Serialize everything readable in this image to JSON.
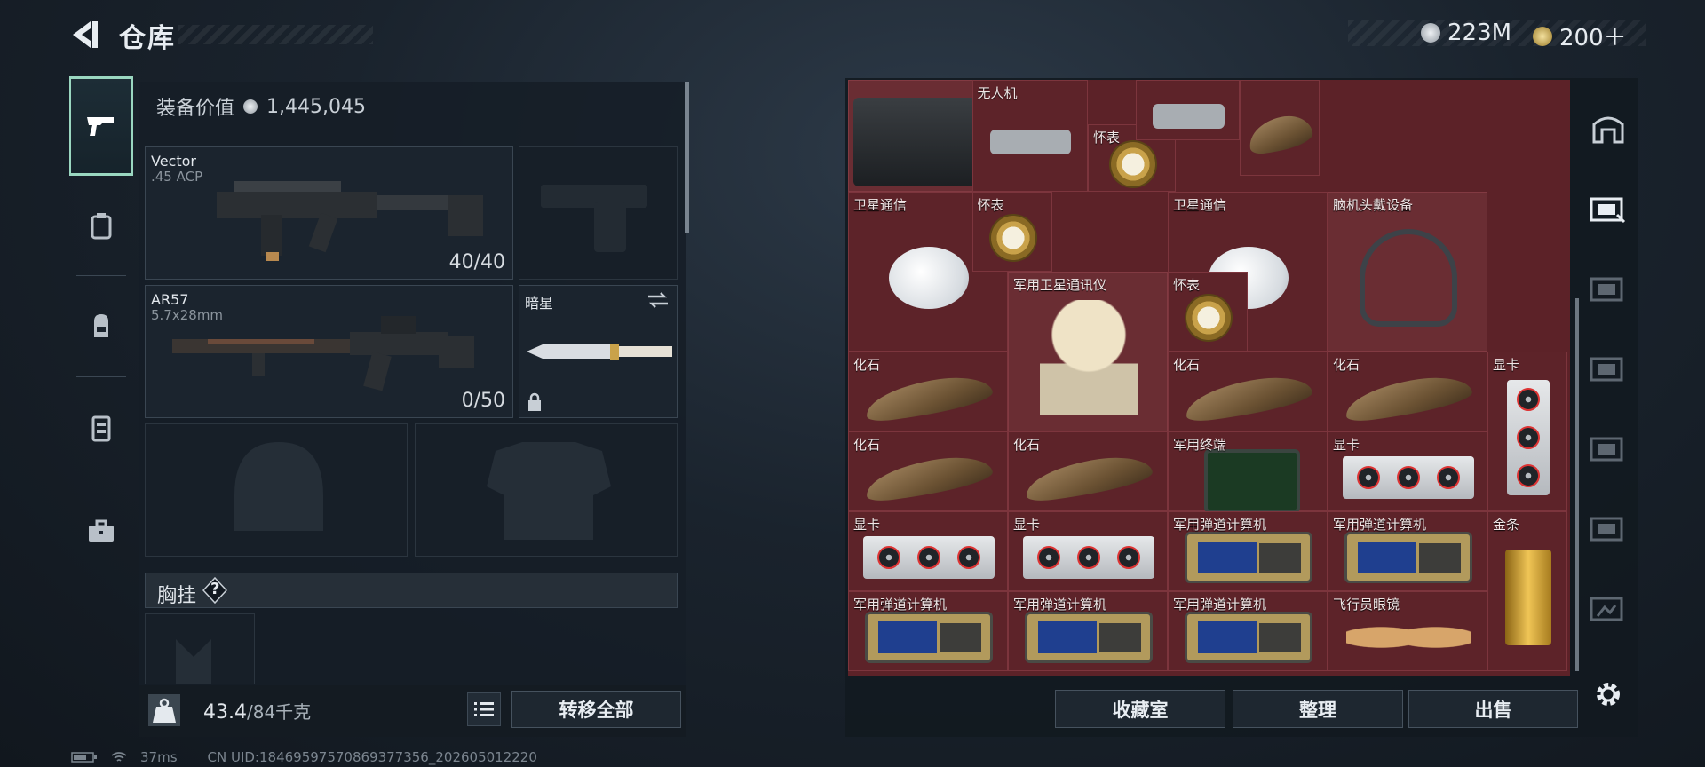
{
  "header": {
    "title": "仓库"
  },
  "currency": [
    {
      "value": "223M",
      "color": "#c9cfd6"
    },
    {
      "value": "200＋",
      "color": "#c9a94f"
    }
  ],
  "left_rail": [
    "gun-icon",
    "armor-icon",
    "backpack-icon",
    "vest-icon",
    "toolbox-icon"
  ],
  "loadout": {
    "value_label": "装备价值",
    "value": "1,445,045",
    "primary": {
      "name": "Vector",
      "caliber": ".45 ACP",
      "ammo": "40/40"
    },
    "secondary": {
      "name": "AR57",
      "caliber": "5.7x28mm",
      "ammo": "0/50"
    },
    "melee": {
      "name": "暗星"
    },
    "rig_title": "胸挂",
    "rig_help": "?"
  },
  "bottom": {
    "weight": "43.4",
    "capacity": "/84千克",
    "transfer_all": "转移全部"
  },
  "status": {
    "ping": "37ms",
    "uid": "CN UID:18469597570869377356_202605012220"
  },
  "stash": {
    "items": [
      {
        "label": "",
        "art": "case"
      },
      {
        "label": "无人机",
        "art": "drone"
      },
      {
        "label": "怀表",
        "art": "watch"
      },
      {
        "label": "",
        "art": "drone"
      },
      {
        "label": "",
        "art": "fossil"
      },
      {
        "label": "卫星通信",
        "art": "dish"
      },
      {
        "label": "怀表",
        "art": "watch"
      },
      {
        "label": "卫星通信",
        "art": "dish"
      },
      {
        "label": "脑机头戴设备",
        "art": "headset"
      },
      {
        "label": "军用卫星通讯仪",
        "art": "comm"
      },
      {
        "label": "怀表",
        "art": "watch"
      },
      {
        "label": "化石",
        "art": "fossil"
      },
      {
        "label": "化石",
        "art": "fossil"
      },
      {
        "label": "化石",
        "art": "fossil"
      },
      {
        "label": "显卡",
        "art": "gpu"
      },
      {
        "label": "化石",
        "art": "fossil"
      },
      {
        "label": "化石",
        "art": "fossil"
      },
      {
        "label": "军用终端",
        "art": "terminal"
      },
      {
        "label": "显卡",
        "art": "gpu"
      },
      {
        "label": "显卡",
        "art": "gpu"
      },
      {
        "label": "显卡",
        "art": "gpu"
      },
      {
        "label": "军用弹道计算机",
        "art": "calc"
      },
      {
        "label": "军用弹道计算机",
        "art": "calc"
      },
      {
        "label": "金条",
        "art": "gold"
      },
      {
        "label": "军用弹道计算机",
        "art": "calc"
      },
      {
        "label": "军用弹道计算机",
        "art": "calc"
      },
      {
        "label": "军用弹道计算机",
        "art": "calc"
      },
      {
        "label": "飞行员眼镜",
        "art": "glasses"
      }
    ],
    "buttons": {
      "collection": "收藏室",
      "sort": "整理",
      "sell": "出售"
    }
  },
  "right_rail": [
    "base-icon",
    "stash-icon-1",
    "stash-icon-4",
    "stash-icon-5",
    "stash-icon-2",
    "stash-icon-3",
    "stash-icon-6",
    "settings-icon"
  ]
}
